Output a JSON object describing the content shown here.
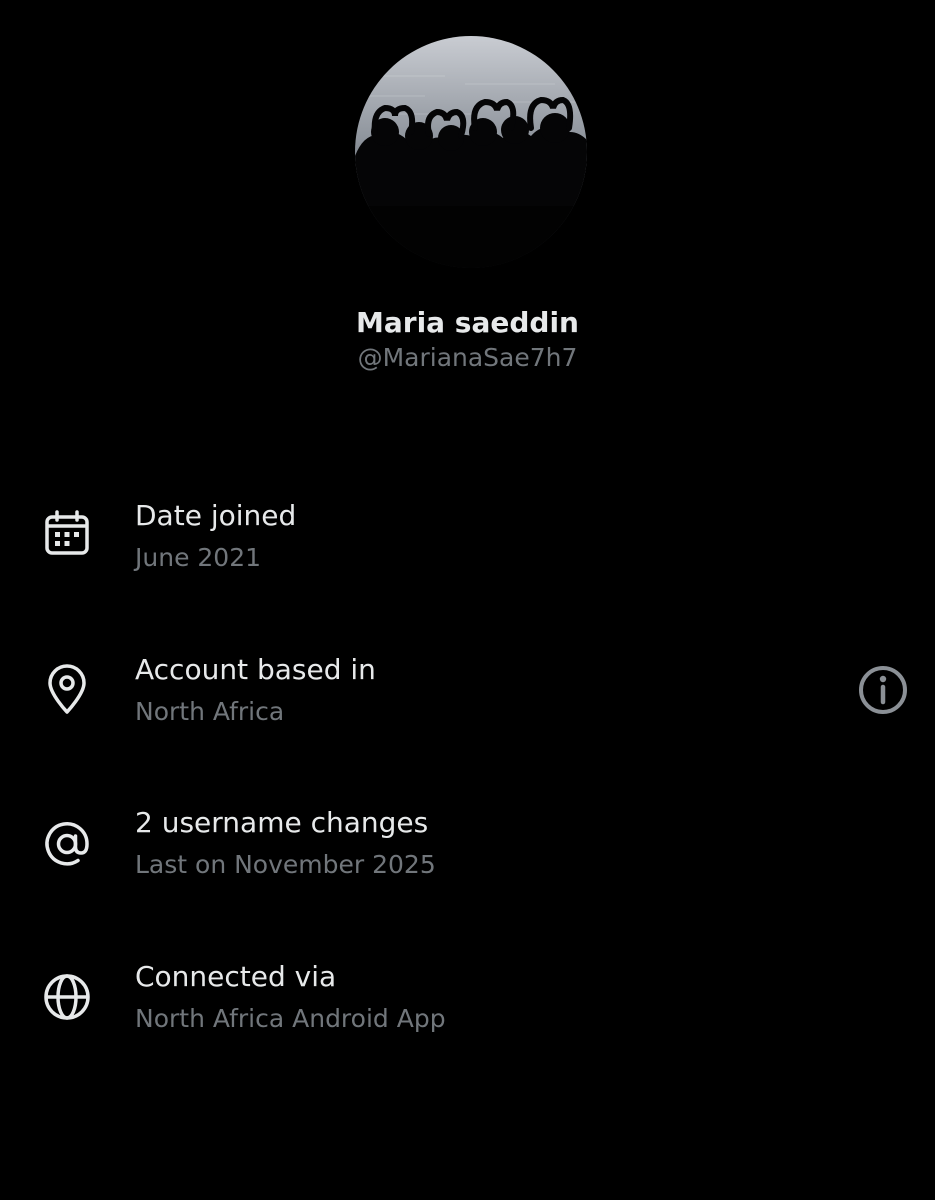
{
  "profile": {
    "name": "Maria saeddin",
    "handle": "@MarianaSae7h7",
    "avatar_icon": "profile-photo"
  },
  "about": {
    "date_joined": {
      "icon": "calendar-icon",
      "title": "Date joined",
      "value": "June 2021"
    },
    "account_based_in": {
      "icon": "location-pin-icon",
      "title": "Account based in",
      "value": "North Africa",
      "info_icon": "info-icon"
    },
    "username_changes": {
      "icon": "at-sign-icon",
      "title": "2 username changes",
      "value": "Last on November 2025"
    },
    "connected_via": {
      "icon": "globe-icon",
      "title": "Connected via",
      "value": "North Africa Android App"
    }
  },
  "colors": {
    "background": "#000000",
    "primary_text": "#e7e9ea",
    "secondary_text": "#71767b"
  }
}
